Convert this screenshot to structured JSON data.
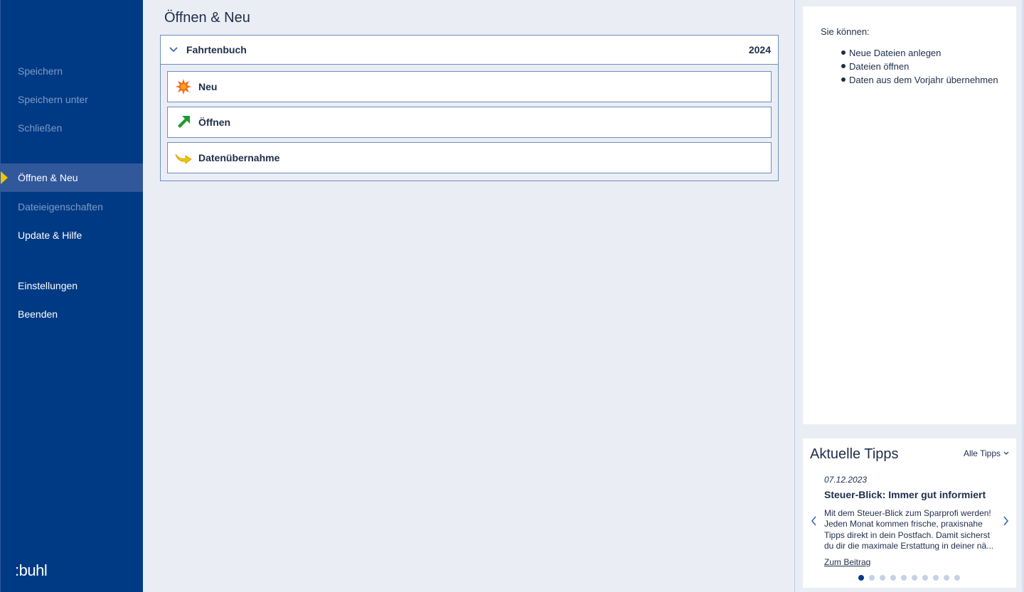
{
  "sidebar": {
    "items": [
      {
        "label": "Speichern",
        "state": "disabled"
      },
      {
        "label": "Speichern unter",
        "state": "disabled"
      },
      {
        "label": "Schließen",
        "state": "disabled"
      },
      {
        "label": "Öffnen & Neu",
        "state": "active"
      },
      {
        "label": "Dateieigenschaften",
        "state": "disabled"
      },
      {
        "label": "Update & Hilfe",
        "state": "enabled"
      },
      {
        "label": "Einstellungen",
        "state": "enabled"
      },
      {
        "label": "Beenden",
        "state": "enabled"
      }
    ],
    "logo": ":buhl"
  },
  "main": {
    "title": "Öffnen & Neu",
    "panel": {
      "title": "Fahrtenbuch",
      "year": "2024",
      "actions": [
        {
          "label": "Neu",
          "icon": "new-star-icon"
        },
        {
          "label": "Öffnen",
          "icon": "open-arrow-icon"
        },
        {
          "label": "Datenübernahme",
          "icon": "data-transfer-arrow-icon"
        }
      ]
    }
  },
  "info": {
    "intro": "Sie können:",
    "items": [
      "Neue Dateien anlegen",
      "Dateien öffnen",
      "Daten aus dem Vorjahr übernehmen"
    ]
  },
  "tips": {
    "title": "Aktuelle Tipps",
    "all_label": "Alle Tipps",
    "date": "07.12.2023",
    "heading": "Steuer-Blick: Immer gut informiert",
    "body": "Mit dem Steuer-Blick zum Sparprofi werden! Jeden Monat kommen frische, praxisnahe Tipps direkt in dein Postfach. Damit sicherst du dir die maximale Erstattung in deiner nä...",
    "link": "Zum Beitrag",
    "page_count": 10,
    "active_page": 1
  },
  "colors": {
    "sidebar_bg": "#003a84",
    "sidebar_active": "#30589b",
    "active_marker": "#f6c300",
    "border_blue": "#6b8ec0",
    "new_icon": "#f26b1d",
    "open_icon": "#1e9a2e",
    "transfer_icon": "#f4c400"
  }
}
